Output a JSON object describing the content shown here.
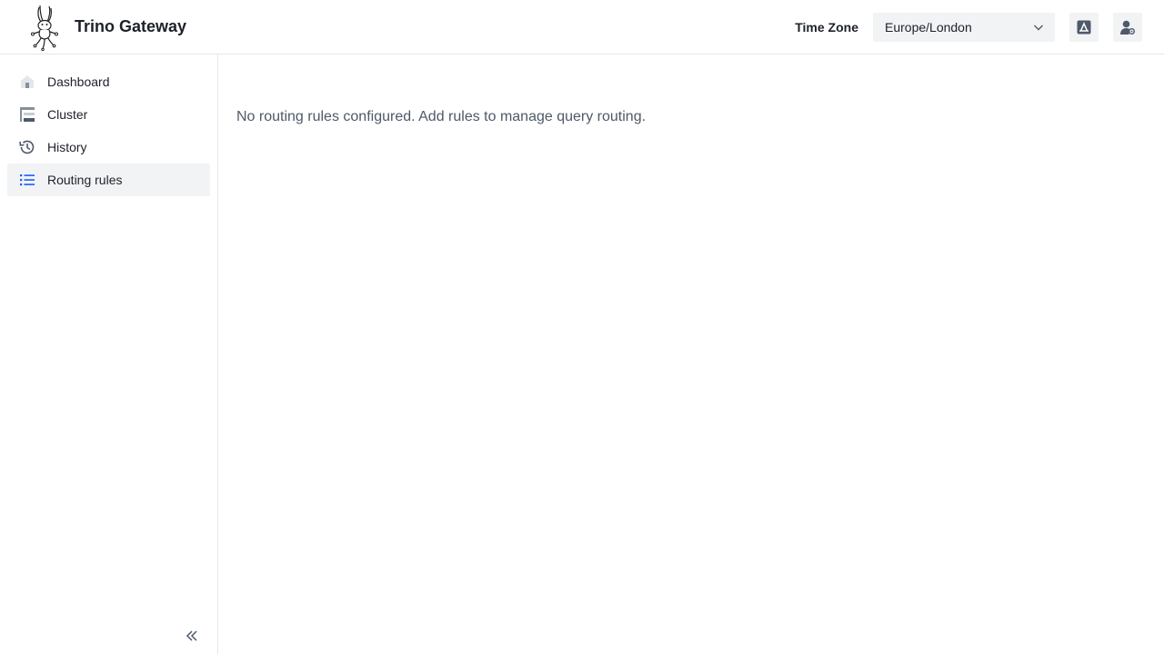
{
  "app": {
    "title": "Trino Gateway",
    "logo_icon": "trino-bunny-logo"
  },
  "header": {
    "timezone_label": "Time Zone",
    "timezone_value": "Europe/London",
    "language_icon": "language-icon",
    "user_icon": "user-settings-icon"
  },
  "sidebar": {
    "items": [
      {
        "label": "Dashboard",
        "icon": "home-icon",
        "active": false
      },
      {
        "label": "Cluster",
        "icon": "cluster-icon",
        "active": false
      },
      {
        "label": "History",
        "icon": "history-icon",
        "active": false
      },
      {
        "label": "Routing rules",
        "icon": "list-icon",
        "active": true
      }
    ],
    "collapse_icon": "double-chevron-left-icon"
  },
  "main": {
    "empty_message": "No routing rules configured. Add rules to manage query routing."
  },
  "colors": {
    "accent": "#165dff",
    "border": "#e5e6eb",
    "active_bg": "#f2f3f5",
    "muted_text": "#4e5969"
  }
}
